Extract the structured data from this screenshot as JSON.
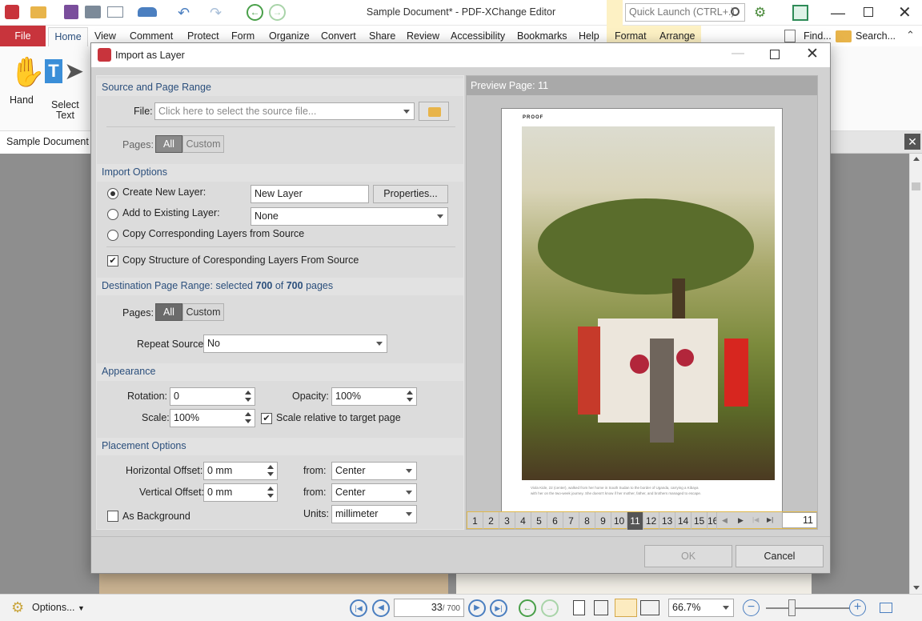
{
  "window": {
    "title": "Sample Document* - PDF-XChange Editor",
    "quick_launch_placeholder": "Quick Launch (CTRL+.)"
  },
  "ribbon": {
    "tabs": [
      "File",
      "Home",
      "View",
      "Comment",
      "Protect",
      "Form",
      "Organize",
      "Convert",
      "Share",
      "Review",
      "Accessibility",
      "Bookmarks",
      "Help",
      "Format",
      "Arrange"
    ],
    "tools": {
      "hand": "Hand",
      "select_text_line1": "Select",
      "select_text_line2": "Text"
    },
    "find": "Find...",
    "search": "Search..."
  },
  "doc_tab": "Sample Document *",
  "dialog": {
    "title": "Import as Layer",
    "source": {
      "header": "Source and Page Range",
      "file_label": "File:",
      "file_placeholder": "Click here to select the source file...",
      "pages_label": "Pages:",
      "all": "All",
      "custom": "Custom"
    },
    "import": {
      "header": "Import Options",
      "create_new": "Create New Layer:",
      "new_layer_value": "New Layer",
      "properties": "Properties...",
      "add_existing": "Add to Existing Layer:",
      "existing_value": "None",
      "copy_layers": "Copy Corresponding Layers from Source",
      "copy_structure": "Copy Structure of Coresponding Layers From Source"
    },
    "destination": {
      "header_prefix": "Destination Page Range: selected ",
      "selected": "700",
      "of": " of ",
      "total": "700",
      "suffix": " pages",
      "pages_label": "Pages:",
      "all": "All",
      "custom": "Custom",
      "repeat_label": "Repeat Source:",
      "repeat_value": "No"
    },
    "appearance": {
      "header": "Appearance",
      "rotation_label": "Rotation:",
      "rotation_value": "0",
      "opacity_label": "Opacity:",
      "opacity_value": "100%",
      "scale_label": "Scale:",
      "scale_value": "100%",
      "scale_relative": "Scale relative to target page"
    },
    "placement": {
      "header": "Placement Options",
      "h_offset_label": "Horizontal Offset:",
      "h_offset_value": "0 mm",
      "v_offset_label": "Vertical Offset:",
      "v_offset_value": "0 mm",
      "from_label": "from:",
      "h_from": "Center",
      "v_from": "Center",
      "units_label": "Units:",
      "units_value": "millimeter",
      "as_background": "As Background"
    },
    "preview": {
      "header": "Preview Page: 11",
      "proof": "PROOF",
      "caption1": "Viola Kide, 22 (center), walked from her home in South Sudan to the border of Uganda, carrying a Kibaya",
      "caption2": "with her on the two-week journey. She doesn't know if her mother, father, and brothers managed to escape.",
      "page_numbers": [
        "1",
        "2",
        "3",
        "4",
        "5",
        "6",
        "7",
        "8",
        "9",
        "10",
        "11",
        "12",
        "13",
        "14",
        "15",
        "16"
      ],
      "current_page": "11",
      "page_input": "11"
    },
    "ok": "OK",
    "cancel": "Cancel"
  },
  "statusbar": {
    "options": "Options...",
    "page": "33",
    "total": "/ 700",
    "zoom": "66.7%"
  }
}
